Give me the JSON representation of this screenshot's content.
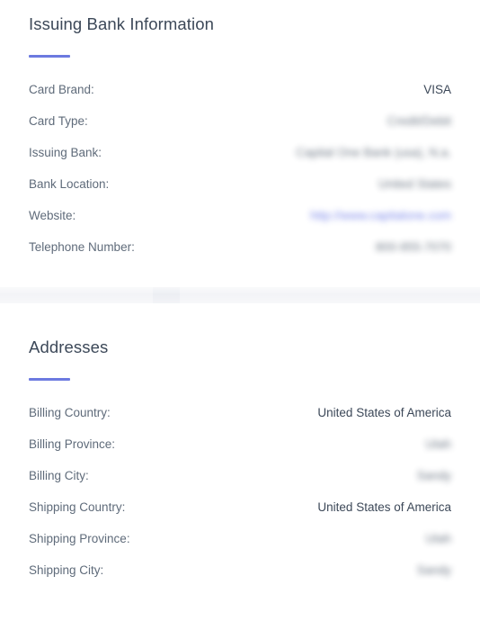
{
  "accent_color": "#6c7ae0",
  "text_color": "#3c4858",
  "label_color": "#5f6b7a",
  "link_color": "#5c6bc0",
  "divider_color": "#f3f4f7",
  "sections": [
    {
      "title": "Issuing Bank Information",
      "rows": [
        {
          "label": "Card Brand:",
          "value": "VISA",
          "redacted": false,
          "link": false
        },
        {
          "label": "Card Type:",
          "value": "Credit/Debit",
          "redacted": true,
          "link": false
        },
        {
          "label": "Issuing Bank:",
          "value": "Capital One Bank (usa), N.a.",
          "redacted": true,
          "link": false
        },
        {
          "label": "Bank Location:",
          "value": "United States",
          "redacted": true,
          "link": false
        },
        {
          "label": "Website:",
          "value": "http://www.capitalone.com",
          "redacted": true,
          "link": true
        },
        {
          "label": "Telephone Number:",
          "value": "800-955-7070",
          "redacted": true,
          "link": false
        }
      ]
    },
    {
      "title": "Addresses",
      "rows": [
        {
          "label": "Billing Country:",
          "value": "United States of America",
          "redacted": false,
          "link": false
        },
        {
          "label": "Billing Province:",
          "value": "Utah",
          "redacted": true,
          "link": false
        },
        {
          "label": "Billing City:",
          "value": "Sandy",
          "redacted": true,
          "link": false
        },
        {
          "label": "Shipping Country:",
          "value": "United States of America",
          "redacted": false,
          "link": false
        },
        {
          "label": "Shipping Province:",
          "value": "Utah",
          "redacted": true,
          "link": false
        },
        {
          "label": "Shipping City:",
          "value": "Sandy",
          "redacted": true,
          "link": false
        }
      ]
    }
  ]
}
